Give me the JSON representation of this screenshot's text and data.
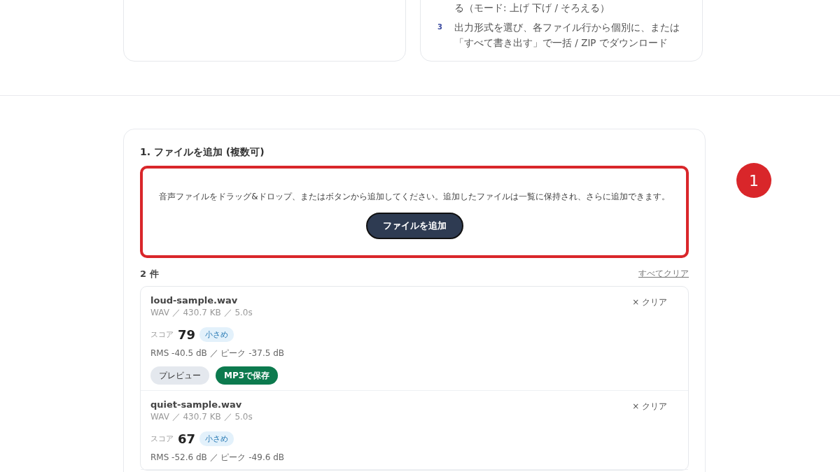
{
  "guide": {
    "steps": [
      {
        "text": "る（モード: 上げ 下げ / そろえる）"
      },
      {
        "number": "3",
        "text": "出力形式を選び、各ファイル行から個別に、または「すべて書き出す」で一括 / ZIP でダウンロード"
      }
    ]
  },
  "upload": {
    "title": "1. ファイルを追加 (複数可)",
    "dropzone": {
      "text": "音声ファイルをドラッグ&ドロップ、またはボタンから追加してください。追加したファイルは一覧に保持され、さらに追加できます。",
      "button": "ファイルを追加"
    },
    "annotation": {
      "number": "1"
    },
    "count": "2 件",
    "clear_all": "すべてクリア",
    "files": [
      {
        "name": "loud-sample.wav",
        "meta": "WAV ／ 430.7 KB ／ 5.0s",
        "clear": "× クリア",
        "score_label": "スコア",
        "score": "79",
        "tag": "小さめ",
        "levels": "RMS -40.5 dB ／ ピーク -37.5 dB",
        "actions": [
          "プレビュー",
          "MP3で保存"
        ]
      },
      {
        "name": "quiet-sample.wav",
        "meta": "WAV ／ 430.7 KB ／ 5.0s",
        "clear": "× クリア",
        "score_label": "スコア",
        "score": "67",
        "tag": "小さめ",
        "levels": "RMS -52.6 dB ／ ピーク -49.6 dB"
      }
    ]
  }
}
